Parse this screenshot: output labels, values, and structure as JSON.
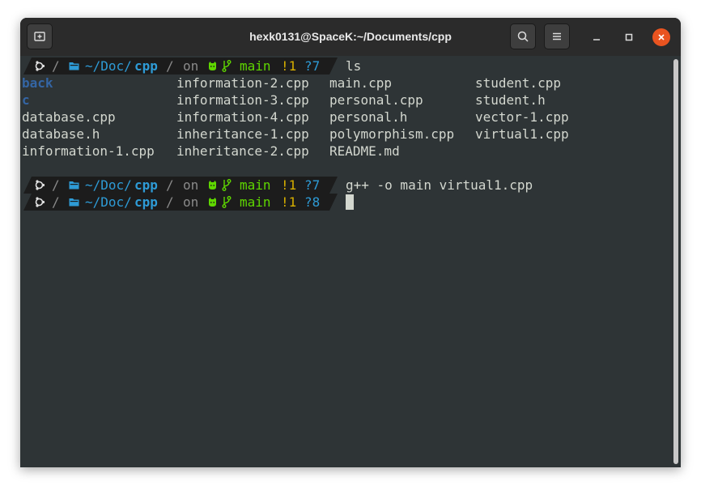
{
  "window": {
    "title": "hexk0131@SpaceK:~/Documents/cpp"
  },
  "prompt": {
    "os_icon": "ubuntu-icon",
    "dir_prefix": "~/Doc/",
    "dir_current": "cpp",
    "on": "on",
    "branch": "main",
    "modified": "!1",
    "separator": "/"
  },
  "commands": [
    {
      "untracked": "?7",
      "text": "ls"
    },
    {
      "untracked": "?7",
      "text": "g++ -o main virtual1.cpp"
    },
    {
      "untracked": "?8",
      "text": ""
    }
  ],
  "listing": {
    "col1": [
      "back",
      "c",
      "database.cpp",
      "database.h",
      "information-1.cpp"
    ],
    "col2": [
      "information-2.cpp",
      "information-3.cpp",
      "information-4.cpp",
      "inheritance-1.cpp",
      "inheritance-2.cpp"
    ],
    "col3": [
      "main.cpp",
      "personal.cpp",
      "personal.h",
      "polymorphism.cpp",
      "README.md"
    ],
    "col4": [
      "student.cpp",
      "student.h",
      "vector-1.cpp",
      "virtual1.cpp"
    ]
  },
  "colors": {
    "prompt_bg": "#1c1c1c",
    "dir_blue": "#2e9bd6",
    "git_green": "#5fd700",
    "modified_yellow": "#d7af00",
    "folder_blue": "#3465a4",
    "close_red": "#e95420"
  }
}
